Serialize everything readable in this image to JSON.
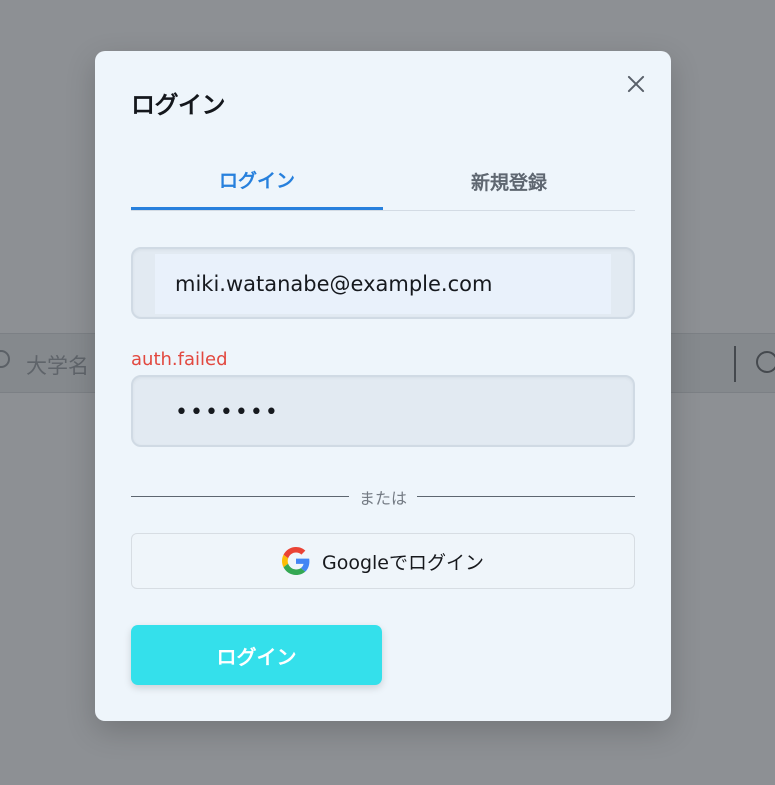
{
  "background": {
    "search_placeholder": "大学名"
  },
  "modal": {
    "title": "ログイン",
    "tabs": [
      {
        "label": "ログイン",
        "active": true
      },
      {
        "label": "新規登録",
        "active": false
      }
    ],
    "email": {
      "value": "miki.watanabe@example.com"
    },
    "error": "auth.failed",
    "password": {
      "value": "•••••••"
    },
    "divider_text": "または",
    "google_button": {
      "label": "Googleでログイン",
      "icon": "google-icon"
    },
    "submit_label": "ログイン"
  },
  "colors": {
    "accent": "#2780dd",
    "error": "#e2483f",
    "submit": "#34e0eb"
  }
}
